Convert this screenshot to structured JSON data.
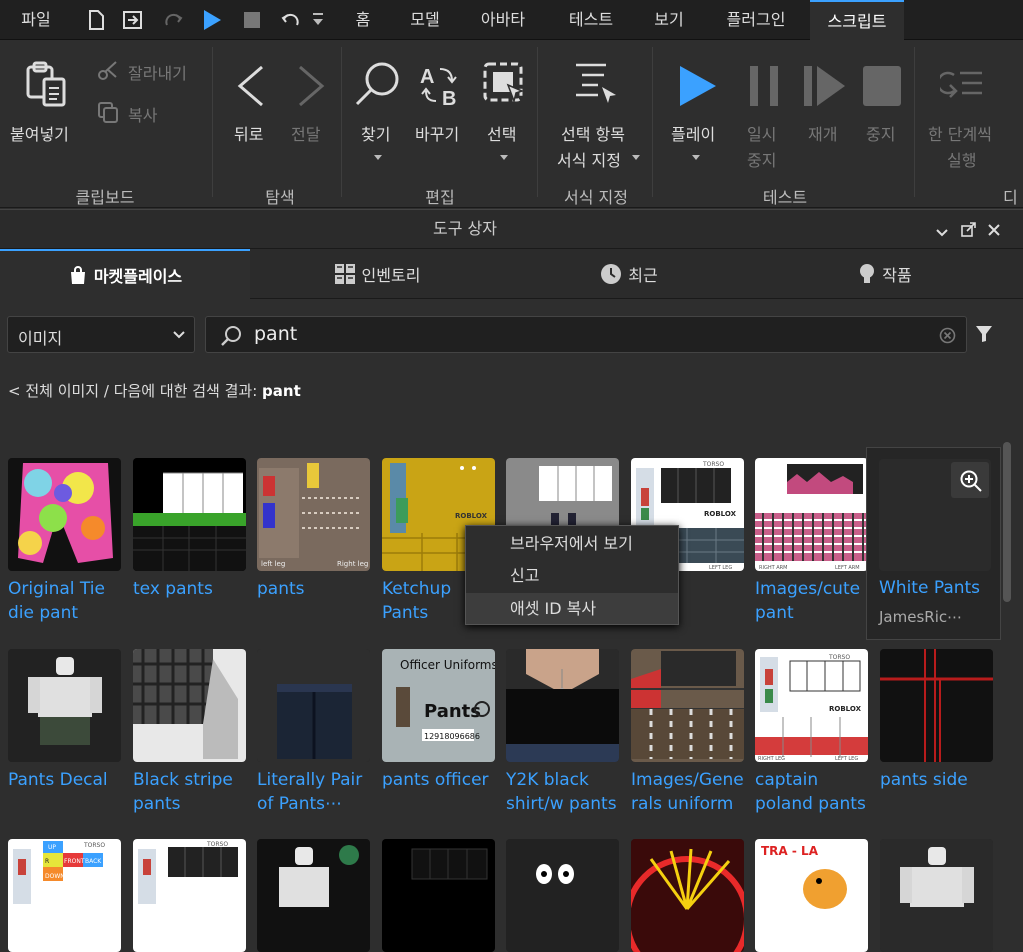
{
  "tabs": {
    "file": "파일",
    "home": "홈",
    "model": "모델",
    "avatar": "아바타",
    "test": "테스트",
    "view": "보기",
    "plugins": "플러그인",
    "script": "스크립트"
  },
  "ribbon": {
    "paste": "붙여넣기",
    "cut": "잘라내기",
    "copy": "복사",
    "clipboard_group": "클립보드",
    "back": "뒤로",
    "forward": "전달",
    "navigate_group": "탐색",
    "find": "찾기",
    "replace": "바꾸기",
    "select": "선택",
    "edit_group": "편집",
    "format_sel_1": "선택 항목",
    "format_sel_2": "서식 지정",
    "format_group": "서식 지정",
    "play": "플레이",
    "pause_1": "일시",
    "pause_2": "중지",
    "resume": "재개",
    "stop": "중지",
    "step_1": "한 단계씩",
    "step_2": "실행",
    "test_group": "테스트",
    "debug_group": "디"
  },
  "toolbox": {
    "title": "도구 상자"
  },
  "market_tabs": {
    "marketplace": "마켓플레이스",
    "inventory": "인벤토리",
    "recent": "최근",
    "creations": "작품"
  },
  "filter": {
    "category": "이미지",
    "search_value": "pant"
  },
  "breadcrumb": {
    "prefix": "< 전체 이미지 / 다음에 대한 검색 결과: ",
    "term": "pant"
  },
  "items_row1": [
    {
      "name": "Original Tie die pant"
    },
    {
      "name": "tex pants"
    },
    {
      "name": "pants"
    },
    {
      "name": "Ketchup Pants"
    },
    {
      "name": ""
    },
    {
      "name": ""
    },
    {
      "name": "Images/cute pant"
    },
    {
      "name": "White Pants",
      "creator": "JamesRic⋯"
    }
  ],
  "items_row2": [
    {
      "name": "Pants Decal"
    },
    {
      "name": "Black stripe pants"
    },
    {
      "name": "Literally Pair of Pants⋯"
    },
    {
      "name": "pants officer"
    },
    {
      "name": "Y2K black shirt/w pants"
    },
    {
      "name": "Images/Gene rals uniform"
    },
    {
      "name": "captain poland pants"
    },
    {
      "name": "pants side"
    }
  ],
  "thumb_text": {
    "torso": "TORSO",
    "roblox": "ROBLOX",
    "officer": "Officer Uniforms",
    "officer_pants": "Pants",
    "officer_id": "12918096686",
    "right_leg": "RIGHT LEG",
    "left_leg": "LEFT LEG",
    "right_arm": "RIGHT ARM",
    "left_arm": "LEFT ARM",
    "up": "UP",
    "front": "FRONT",
    "back": "BACK",
    "down": "DOWN",
    "r": "R",
    "l": "L",
    "tralala": "TRA - LA"
  },
  "context_menu": {
    "view_browser": "브라우저에서 보기",
    "report": "신고",
    "copy_asset_id": "애셋 ID 복사"
  },
  "colors": {
    "accent": "#3ba1ff",
    "bg": "#2e2e2e"
  }
}
